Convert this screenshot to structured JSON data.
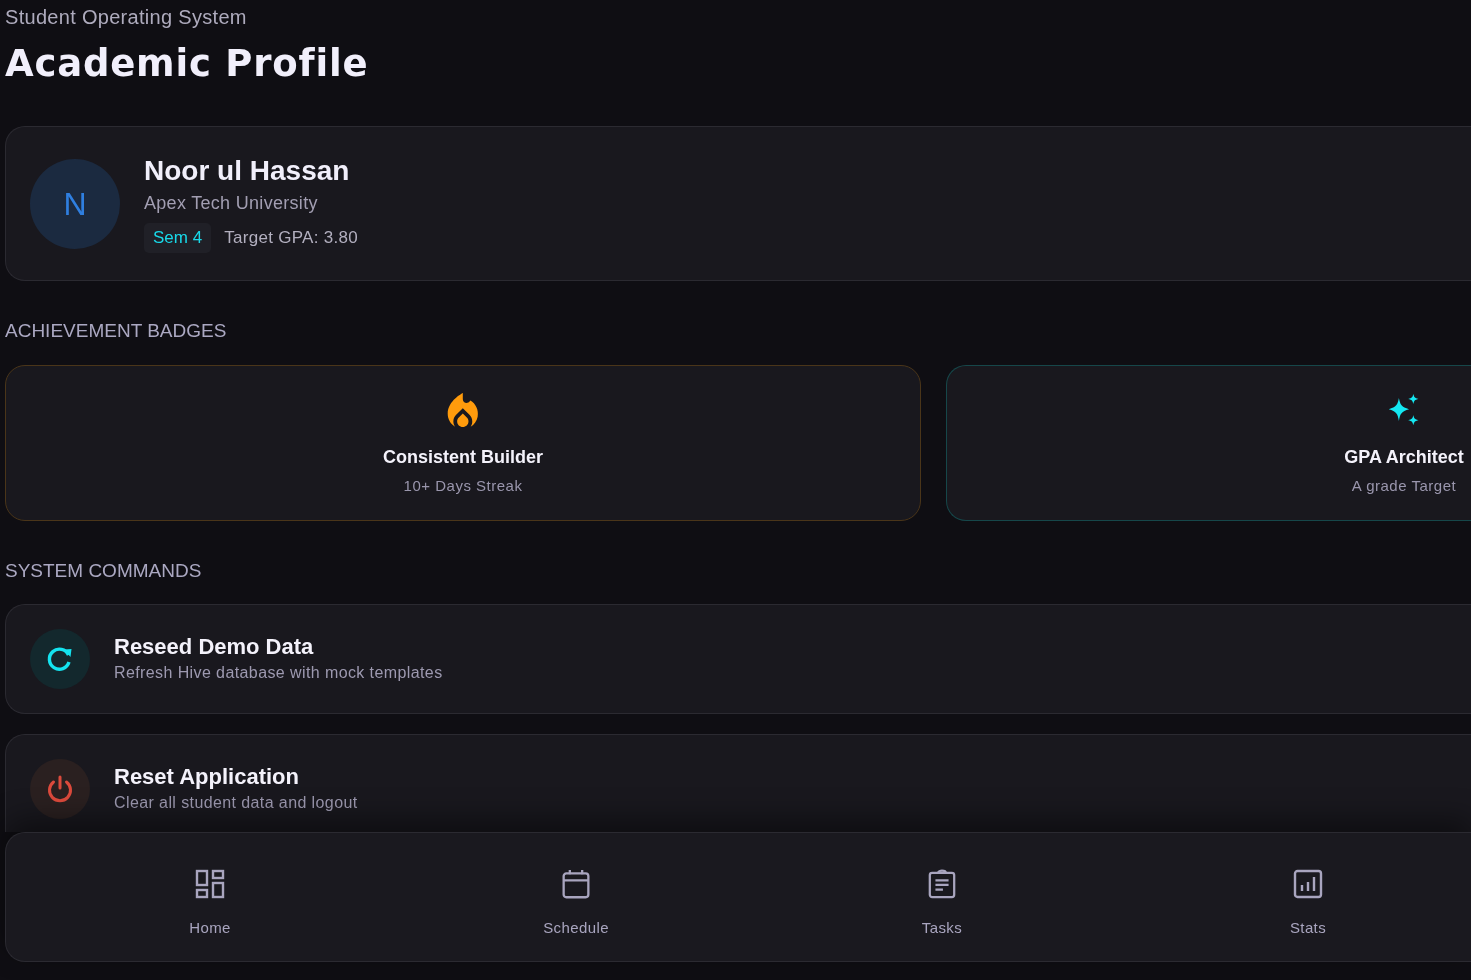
{
  "header": {
    "subtitle": "Student Operating System",
    "title": "Academic Profile"
  },
  "profile": {
    "avatar_initial": "N",
    "name": "Noor ul Hassan",
    "university": "Apex Tech University",
    "semester": "Sem 4",
    "target_gpa": "Target GPA: 3.80"
  },
  "badges_section": {
    "title": "ACHIEVEMENT BADGES",
    "badges": [
      {
        "kind": "streak",
        "title": "Consistent Builder",
        "subtitle": "10+ Days Streak"
      },
      {
        "kind": "gpa",
        "title": "GPA Architect",
        "subtitle": "A grade Target"
      }
    ]
  },
  "commands_section": {
    "title": "SYSTEM COMMANDS",
    "commands": [
      {
        "kind": "reseed",
        "title": "Reseed Demo Data",
        "subtitle": "Refresh Hive database with mock templates"
      },
      {
        "kind": "reset",
        "title": "Reset Application",
        "subtitle": "Clear all student data and logout"
      }
    ]
  },
  "bottom_nav": {
    "items": [
      {
        "kind": "home",
        "label": "Home",
        "selected": false
      },
      {
        "kind": "schedule",
        "label": "Schedule",
        "selected": false
      },
      {
        "kind": "tasks",
        "label": "Tasks",
        "selected": false
      },
      {
        "kind": "stats",
        "label": "Stats",
        "selected": false
      }
    ]
  }
}
